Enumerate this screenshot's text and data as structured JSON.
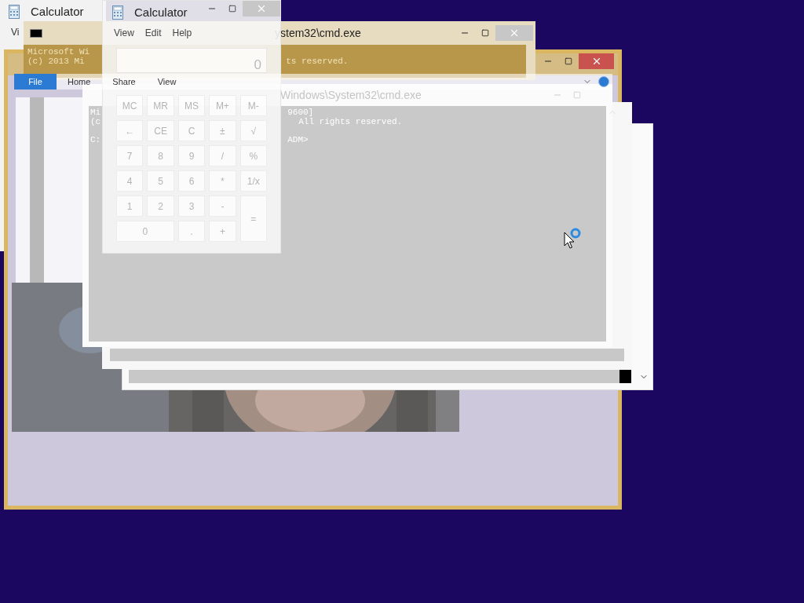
{
  "calculator_back": {
    "title": "Calculator",
    "menu": [
      "Vi"
    ]
  },
  "cmd_back": {
    "title": "ystem32\\cmd.exe",
    "lines_left": [
      "Microsoft Wi",
      "(c) 2013 Mi"
    ],
    "lines_right": [
      "ts reserved."
    ]
  },
  "explorer": {
    "ribbon_tabs": [
      {
        "label": "File",
        "selected": true
      },
      {
        "label": "Home",
        "selected": false
      },
      {
        "label": "Share",
        "selected": false
      },
      {
        "label": "View",
        "selected": false
      }
    ]
  },
  "cmd_front": {
    "title": "Windows\\System32\\cmd.exe",
    "lines_left": [
      "Mi",
      "(c",
      "C:"
    ],
    "lines_right": [
      "9600]",
      "All rights reserved.",
      "ADM>"
    ]
  },
  "calculator": {
    "title": "Calculator",
    "menu": [
      "View",
      "Edit",
      "Help"
    ],
    "display": "0",
    "keys": [
      {
        "label": "MC",
        "kind": "normal"
      },
      {
        "label": "MR",
        "kind": "normal"
      },
      {
        "label": "MS",
        "kind": "normal"
      },
      {
        "label": "M+",
        "kind": "normal"
      },
      {
        "label": "M-",
        "kind": "normal"
      },
      {
        "label": "←",
        "kind": "normal"
      },
      {
        "label": "CE",
        "kind": "normal"
      },
      {
        "label": "C",
        "kind": "normal"
      },
      {
        "label": "±",
        "kind": "normal"
      },
      {
        "label": "√",
        "kind": "normal"
      },
      {
        "label": "7",
        "kind": "normal"
      },
      {
        "label": "8",
        "kind": "normal"
      },
      {
        "label": "9",
        "kind": "normal"
      },
      {
        "label": "/",
        "kind": "normal"
      },
      {
        "label": "%",
        "kind": "normal"
      },
      {
        "label": "4",
        "kind": "normal"
      },
      {
        "label": "5",
        "kind": "normal"
      },
      {
        "label": "6",
        "kind": "normal"
      },
      {
        "label": "*",
        "kind": "normal"
      },
      {
        "label": "1/x",
        "kind": "normal"
      },
      {
        "label": "1",
        "kind": "normal"
      },
      {
        "label": "2",
        "kind": "normal"
      },
      {
        "label": "3",
        "kind": "normal"
      },
      {
        "label": "-",
        "kind": "normal"
      },
      {
        "label": "=",
        "kind": "tall"
      },
      {
        "label": "0",
        "kind": "wide"
      },
      {
        "label": ".",
        "kind": "normal"
      },
      {
        "label": "+",
        "kind": "normal"
      }
    ]
  }
}
